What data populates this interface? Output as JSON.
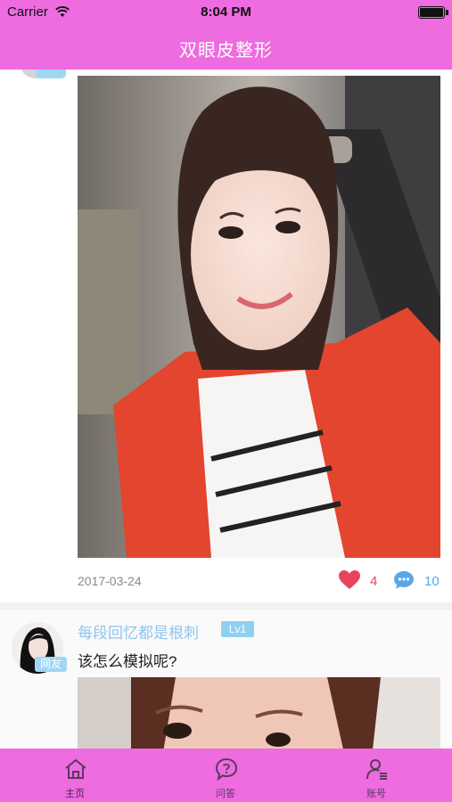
{
  "status_bar": {
    "carrier": "Carrier",
    "time": "8:04 PM"
  },
  "header": {
    "title": "双眼皮整形"
  },
  "colors": {
    "brand": "#ee6be0",
    "like": "#e8455d",
    "comment": "#5aa7e6",
    "tag": "#9fd7f3"
  },
  "posts": [
    {
      "date": "2017-03-24",
      "likes": "4",
      "comments": "10",
      "photo": "selfie-photo"
    },
    {
      "avatar_tag": "网友",
      "username": "每段回忆都是根刺",
      "level": "Lv1",
      "text": "该怎么模拟呢?",
      "photo": "face-closeup-photo"
    }
  ],
  "tabs": [
    {
      "label": "主页",
      "icon": "home-icon"
    },
    {
      "label": "问答",
      "icon": "qa-icon"
    },
    {
      "label": "账号",
      "icon": "account-icon"
    }
  ]
}
